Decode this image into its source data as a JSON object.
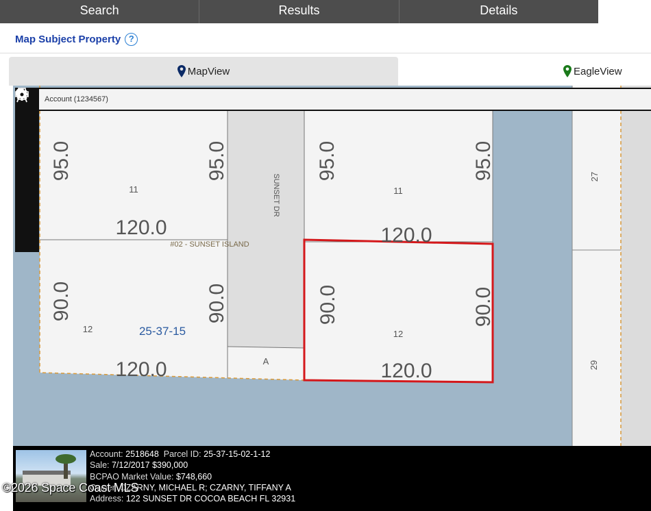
{
  "nav": {
    "tabs": [
      "Search",
      "Results",
      "Details"
    ]
  },
  "subject": {
    "label": "Map Subject Property",
    "help_symbol": "?"
  },
  "views": {
    "map_label": "MapView",
    "eagle_label": "EagleView",
    "map_pin_color": "#0b2a66",
    "eagle_pin_color": "#1a7a1a"
  },
  "map": {
    "account_bar": "Account (1234567)",
    "street": "SUNSET DR",
    "subdivision": "#02 - SUNSET ISLAND",
    "section_label": "25-37-15",
    "tract_label": "A",
    "lots": {
      "ul": {
        "lot": "11",
        "left": "95.0",
        "right": "95.0",
        "bottom": "120.0"
      },
      "ur": {
        "lot": "11",
        "left": "95.0",
        "right": "95.0",
        "bottom": "120.0"
      },
      "ll": {
        "lot": "12",
        "left": "90.0",
        "right": "90.0",
        "bottom": "120.0"
      },
      "lr": {
        "lot": "12",
        "left": "90.0",
        "right": "90.0",
        "bottom": "120.0"
      }
    },
    "right_lots": [
      "27",
      "29"
    ],
    "water_color": "#9fb6c8",
    "highlight_color": "#d4181b"
  },
  "toolbar": {
    "icons": [
      "search-icon",
      "zoom-in-icon",
      "home-icon",
      "zoom-out-icon",
      "measure-icon",
      "print-icon",
      "settings-icon"
    ]
  },
  "info": {
    "account_label": "Account:",
    "account": "2518648",
    "parcel_label": "Parcel ID:",
    "parcel": "25-37-15-02-1-12",
    "sale_label": "Sale:",
    "sale": "7/12/2017 $390,000",
    "market_label": "BCPAO Market Value:",
    "market": "$748,660",
    "owner_label": "Owner:",
    "owner": "CZARNY, MICHAEL R; CZARNY, TIFFANY A",
    "address_label": "Address:",
    "address": "122 SUNSET DR COCOA BEACH FL 32931"
  },
  "watermark": "©2026 Space Coast MLS"
}
